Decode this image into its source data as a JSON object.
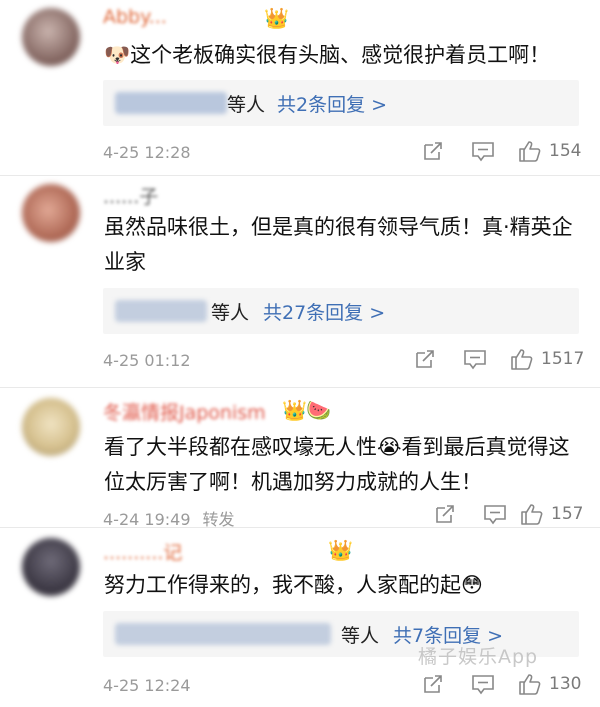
{
  "comments": [
    {
      "username": "Abby...",
      "text": "这个老板确实很有头脑、感觉很护着员工啊！",
      "reply_suffix": "等人",
      "reply_count": "共2条回复 >",
      "time": "4-25 12:28",
      "likes": "154"
    },
    {
      "username": "......子",
      "text": "虽然品味很土，但是真的很有领导气质！真·精英企业家",
      "reply_suffix": "等人",
      "reply_count": "共27条回复 >",
      "time": "4-25 01:12",
      "likes": "1517"
    },
    {
      "username": "冬瀛情报Japonism",
      "text": "看了大半段都在感叹壕无人性😭看到最后真觉得这位太厉害了啊！机遇加努力成就的人生！",
      "time": "4-24 19:49",
      "share_text": "转发",
      "likes": "157"
    },
    {
      "username": "..........记",
      "text": "努力工作得来的，我不酸，人家配的起😳",
      "reply_suffix": "等人",
      "reply_count": "共7条回复 >",
      "time": "4-25 12:24",
      "likes": "130"
    }
  ],
  "watermark": "橘子娱乐App",
  "colors": {
    "link": "#3f6fb5",
    "meta": "#9a9a9a",
    "reply_bg": "#f5f5f5"
  },
  "icons": [
    "vip-crown-icon",
    "share-icon",
    "comment-icon",
    "like-thumb-icon",
    "watermelon-icon",
    "doge-emoji-icon"
  ]
}
